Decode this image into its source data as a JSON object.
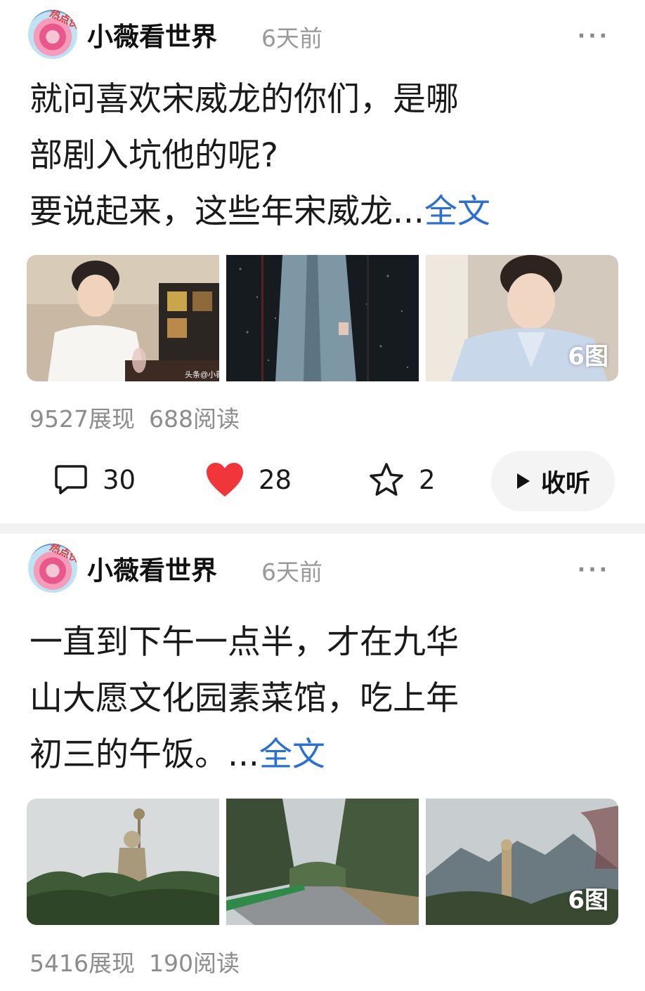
{
  "posts": [
    {
      "author": "小薇看世界",
      "avatar_badge": "热点侠",
      "time": "6天前",
      "more_icon": "···",
      "text_lines": [
        "就问喜欢宋威龙的你们，是哪",
        "部剧入坑他的呢?"
      ],
      "text_last": "要说起来，这些年宋威龙...",
      "fulltext_label": "全文",
      "image_count": "6图",
      "watermark1": "头条@小薇",
      "views": "9527展现",
      "reads": "688阅读",
      "comments": "30",
      "likes": "28",
      "favorites": "2",
      "listen_label": "收听"
    },
    {
      "author": "小薇看世界",
      "avatar_badge": "热点侠",
      "time": "6天前",
      "more_icon": "···",
      "text_lines": [
        "一直到下午一点半，才在九华",
        "山大愿文化园素菜馆，吃上年"
      ],
      "text_last": "初三的午饭。...",
      "fulltext_label": "全文",
      "image_count": "6图",
      "views": "5416展现",
      "reads": "190阅读"
    }
  ],
  "colors": {
    "link": "#2d6fd1",
    "like": "#f0353b",
    "muted": "#8c8c8c"
  },
  "icons": [
    "comment-icon",
    "heart-icon",
    "star-icon",
    "play-icon",
    "more-icon"
  ]
}
